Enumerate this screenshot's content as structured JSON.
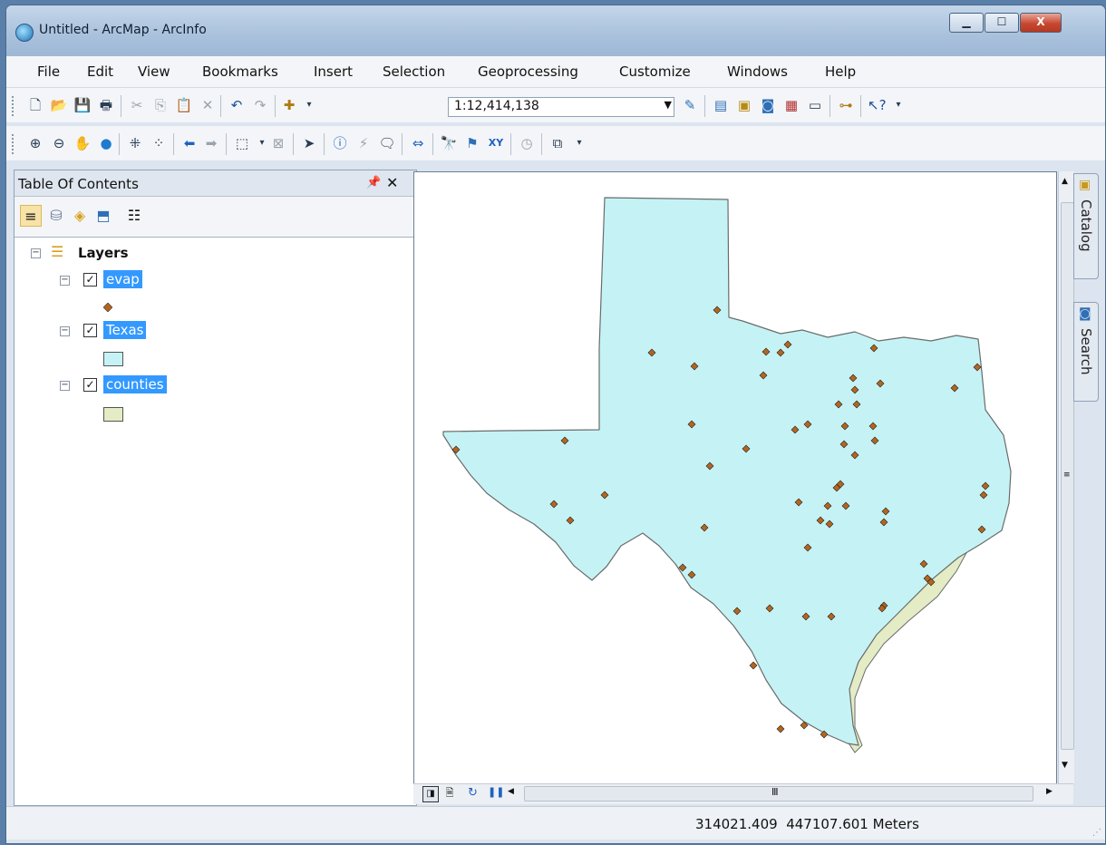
{
  "window": {
    "title": "Untitled - ArcMap - ArcInfo"
  },
  "menu": [
    "File",
    "Edit",
    "View",
    "Bookmarks",
    "Insert",
    "Selection",
    "Geoprocessing",
    "Customize",
    "Windows",
    "Help"
  ],
  "toolbar": {
    "scale": "1:12,414,138"
  },
  "toc": {
    "title": "Table Of Contents",
    "root_label": "Layers",
    "layers": [
      {
        "name": "evap",
        "symbol": "point",
        "color": "#b5651d"
      },
      {
        "name": "Texas",
        "symbol": "polygon",
        "color": "#c5f3f5"
      },
      {
        "name": "counties",
        "symbol": "polygon",
        "color": "#e3ecc5"
      }
    ]
  },
  "sidebar_tabs": [
    "Catalog",
    "Search"
  ],
  "status": {
    "coordinates": "314021.409  447107.601 Meters"
  },
  "map": {
    "fill": "#c5f3f5",
    "coast_fill": "#e3ecc5",
    "point_color": "#b5651d"
  }
}
